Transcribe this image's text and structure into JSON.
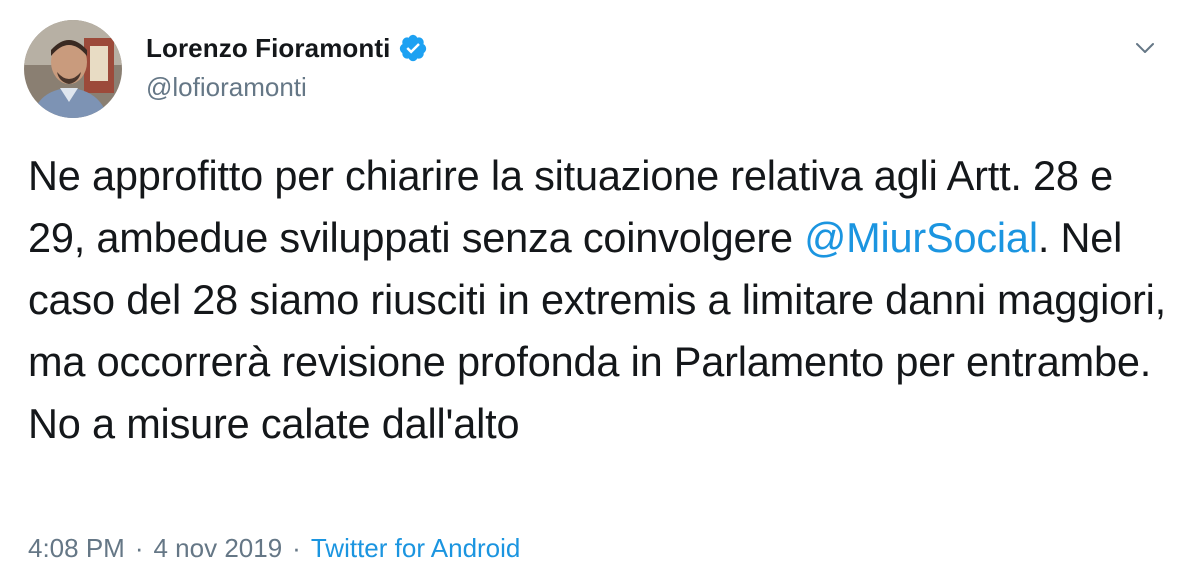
{
  "author": {
    "display_name": "Lorenzo Fioramonti",
    "handle": "@lofioramonti",
    "verified": true
  },
  "tweet": {
    "text_before": "Ne approfitto per chiarire la situazione relativa agli Artt. 28 e 29, ambedue sviluppati senza coinvolgere ",
    "mention": "@MiurSocial",
    "text_after": ". Nel caso del 28 siamo riusciti in extremis a limitare danni maggiori, ma occorrerà revisione profonda in Parlamento per entrambe. No a misure calate dall'alto"
  },
  "meta": {
    "time": "4:08 PM",
    "separator1": "·",
    "date": "4 nov 2019",
    "separator2": "·",
    "source": "Twitter for Android"
  },
  "colors": {
    "link": "#1b95e0",
    "secondary": "#657786",
    "text": "#14171a"
  },
  "icons": {
    "verified": "verified-badge-icon",
    "menu": "chevron-down-icon"
  }
}
